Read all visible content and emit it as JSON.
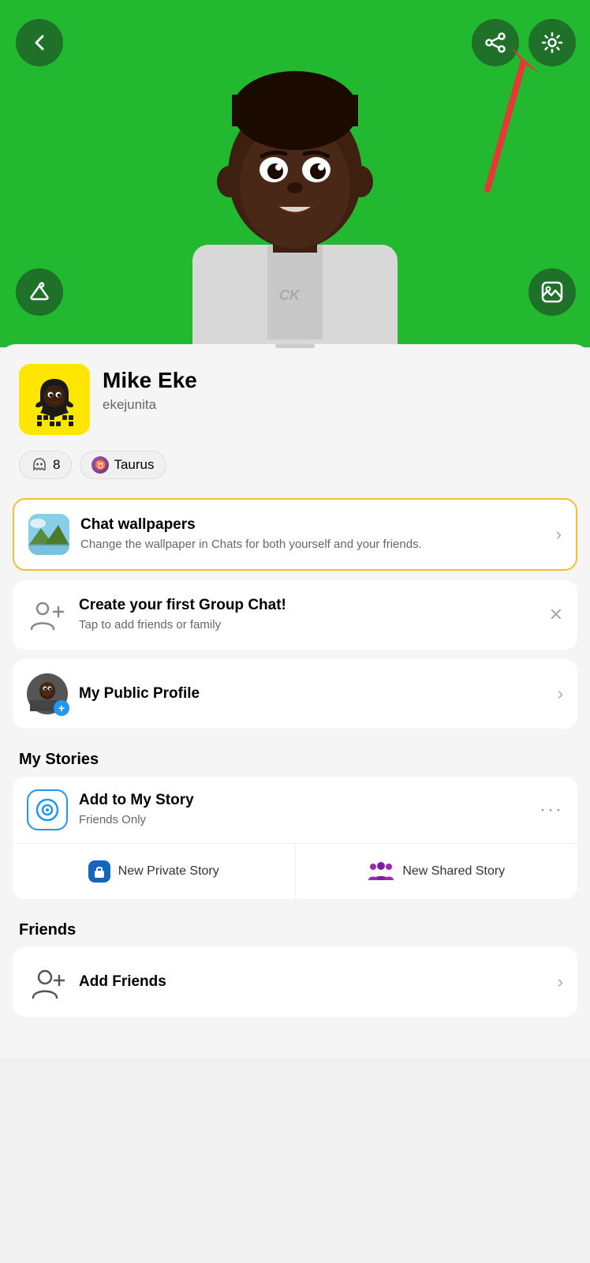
{
  "header": {
    "back_label": "back",
    "share_label": "share",
    "settings_label": "settings",
    "hanger_label": "hanger",
    "gallery_label": "gallery",
    "bg_color": "#22b830"
  },
  "profile": {
    "name": "Mike Eke",
    "username": "ekejunita",
    "score": "8",
    "zodiac": "Taurus"
  },
  "cards": {
    "wallpapers": {
      "title": "Chat wallpapers",
      "subtitle": "Change the wallpaper in Chats for both yourself and your friends."
    },
    "group_chat": {
      "title": "Create your first Group Chat!",
      "subtitle": "Tap to add friends or family"
    },
    "public_profile": {
      "title": "My Public Profile"
    }
  },
  "my_stories": {
    "section_label": "My Stories",
    "add_label": "Add to My Story",
    "add_subtitle": "Friends Only",
    "new_private_label": "New Private Story",
    "new_shared_label": "New Shared Story"
  },
  "friends": {
    "section_label": "Friends",
    "add_friends_label": "Add Friends"
  }
}
